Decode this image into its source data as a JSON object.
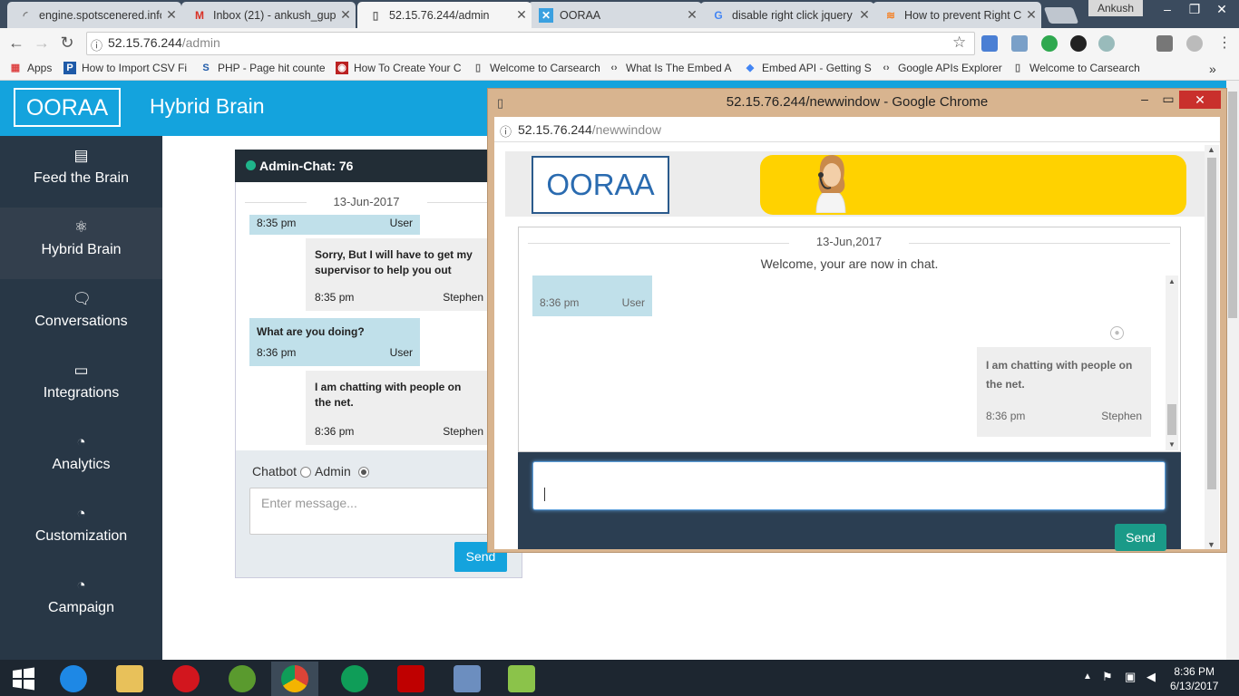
{
  "browser": {
    "tabs": [
      {
        "title": "engine.spotscenered.info",
        "icon": "loading-icon"
      },
      {
        "title": "Inbox (21) - ankush_gup",
        "icon": "gmail-icon"
      },
      {
        "title": "52.15.76.244/admin",
        "icon": "page-icon"
      },
      {
        "title": "OORAA",
        "icon": "ooraa-icon"
      },
      {
        "title": "disable right click jquery",
        "icon": "google-icon"
      },
      {
        "title": "How to prevent Right Cl",
        "icon": "stackoverflow-icon"
      }
    ],
    "profile_name": "Ankush",
    "url_host": "52.15.76.244",
    "url_path": "/admin",
    "bookmarks": [
      "Apps",
      "How to Import CSV Fi",
      "PHP - Page hit counte",
      "How To Create Your C",
      "Welcome to Carsearch",
      "What Is The Embed A",
      "Embed API - Getting S",
      "Google APIs Explorer",
      "Welcome to Carsearch"
    ],
    "more_bookmarks": "»"
  },
  "app": {
    "logo": "OORAA",
    "title": "Hybrid Brain",
    "sidebar": [
      {
        "label": "Feed the Brain",
        "icon": "document-icon"
      },
      {
        "label": "Hybrid Brain",
        "icon": "atom-icon"
      },
      {
        "label": "Conversations",
        "icon": "chat-bubbles-icon"
      },
      {
        "label": "Integrations",
        "icon": "monitor-icon"
      },
      {
        "label": "Analytics",
        "icon": "pie-chart-icon"
      },
      {
        "label": "Customization",
        "icon": "pie-chart-icon"
      },
      {
        "label": "Campaign",
        "icon": "pie-chart-icon"
      }
    ],
    "chat": {
      "header": "Admin-Chat: 76",
      "date": "13-Jun-2017",
      "messages": [
        {
          "from": "User",
          "time": "8:35 pm",
          "text": ""
        },
        {
          "from": "Stephen",
          "time": "8:35 pm",
          "text": "Sorry, But I will have to get my supervisor to help you out"
        },
        {
          "from": "User",
          "time": "8:36 pm",
          "text": "What are you doing?"
        },
        {
          "from": "Stephen",
          "time": "8:36 pm",
          "text": "I am chatting with people on the net."
        }
      ],
      "mode_chatbot": "Chatbot",
      "mode_admin": "Admin",
      "input_placeholder": "Enter message...",
      "send": "Send"
    }
  },
  "popup": {
    "title": "52.15.76.244/newwindow - Google Chrome",
    "url_host": "52.15.76.244",
    "url_path": "/newwindow",
    "logo": "OORAA",
    "date": "13-Jun,2017",
    "welcome": "Welcome, your are now in chat.",
    "messages": [
      {
        "from": "User",
        "time": "8:36 pm",
        "text": ""
      },
      {
        "from": "Stephen",
        "time": "8:36 pm",
        "text": "I am chatting with people on the net."
      }
    ],
    "input_value": "",
    "send": "Send"
  },
  "taskbar": {
    "time": "8:36 PM",
    "date": "6/13/2017"
  }
}
